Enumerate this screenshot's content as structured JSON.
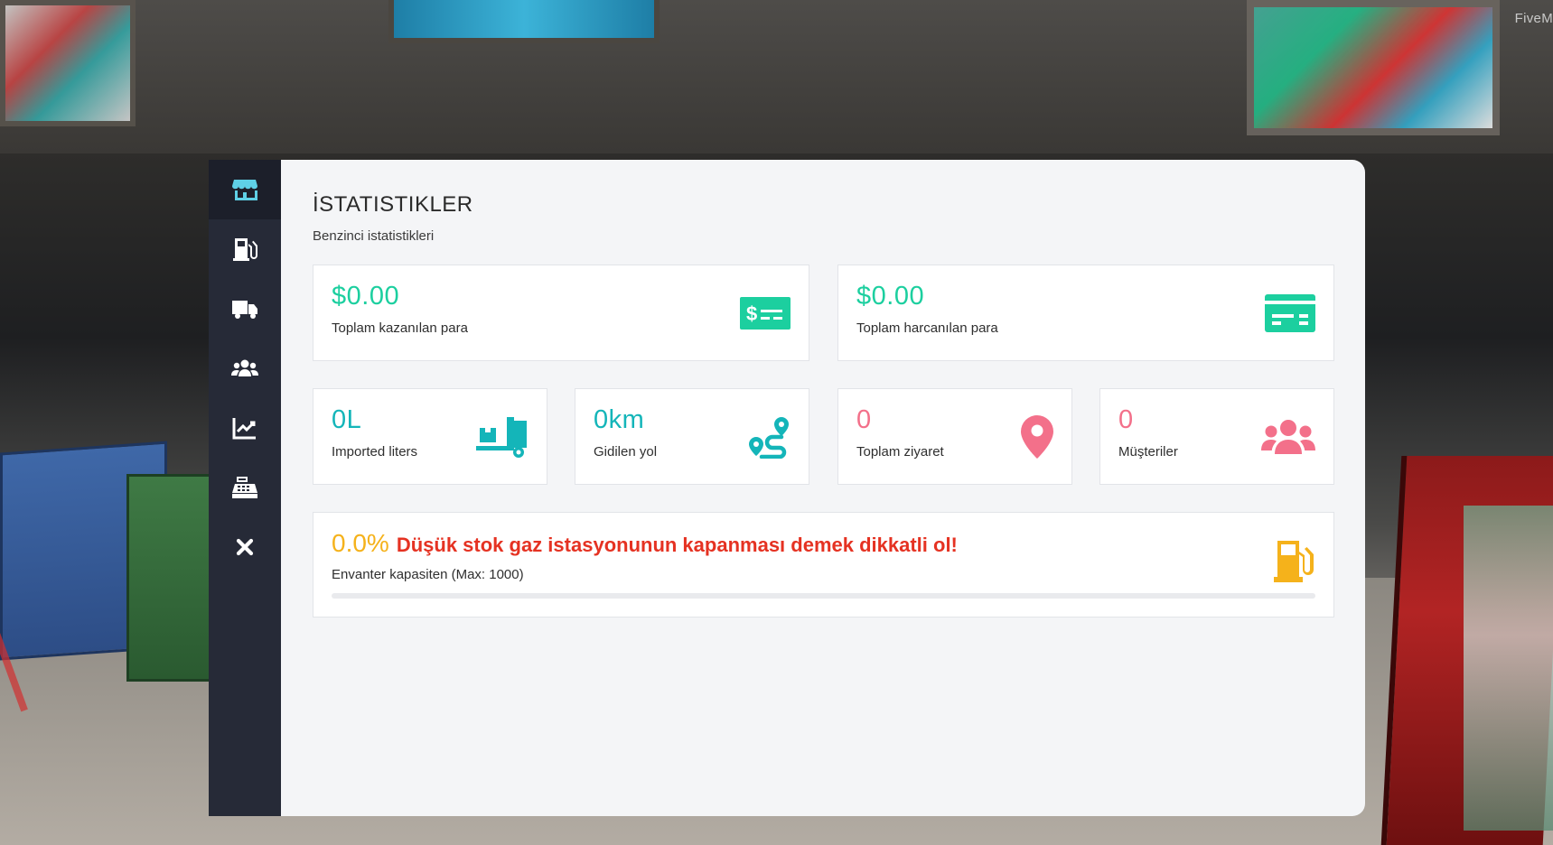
{
  "overlay": {
    "fivem_label": "FiveM"
  },
  "sidebar": {
    "items": [
      {
        "icon": "store-icon",
        "active": true
      },
      {
        "icon": "gas-pump-icon",
        "active": false
      },
      {
        "icon": "truck-icon",
        "active": false
      },
      {
        "icon": "users-icon",
        "active": false
      },
      {
        "icon": "chart-line-icon",
        "active": false
      },
      {
        "icon": "cash-register-icon",
        "active": false
      },
      {
        "icon": "close-icon",
        "active": false
      }
    ]
  },
  "page": {
    "title": "İSTATISTIKLER",
    "subtitle": "Benzinci istatistikleri"
  },
  "stats": {
    "earned": {
      "value": "$0.00",
      "label": "Toplam kazanılan para",
      "icon": "money-bill-icon",
      "color": "#1ccf9f"
    },
    "spent": {
      "value": "$0.00",
      "label": "Toplam harcanılan para",
      "icon": "credit-card-icon",
      "color": "#1ccf9f"
    },
    "liters": {
      "value": "0L",
      "label": "Imported liters",
      "icon": "truck-loading-icon",
      "color": "#14b5b9"
    },
    "distance": {
      "value": "0km",
      "label": "Gidilen yol",
      "icon": "route-icon",
      "color": "#14b5b9"
    },
    "visits": {
      "value": "0",
      "label": "Toplam ziyaret",
      "icon": "map-marker-icon",
      "color": "#f3708a"
    },
    "customers": {
      "value": "0",
      "label": "Müşteriler",
      "icon": "users-icon",
      "color": "#f3708a"
    }
  },
  "stock": {
    "percent_text": "0.0%",
    "percent_value": 0.0,
    "warning": "Düşük stok gaz istasyonunun kapanması demek dikkatli ol!",
    "label": "Envanter kapasiten (Max: 1000)",
    "icon": "gas-pump-icon",
    "color": "#f5b21b"
  }
}
